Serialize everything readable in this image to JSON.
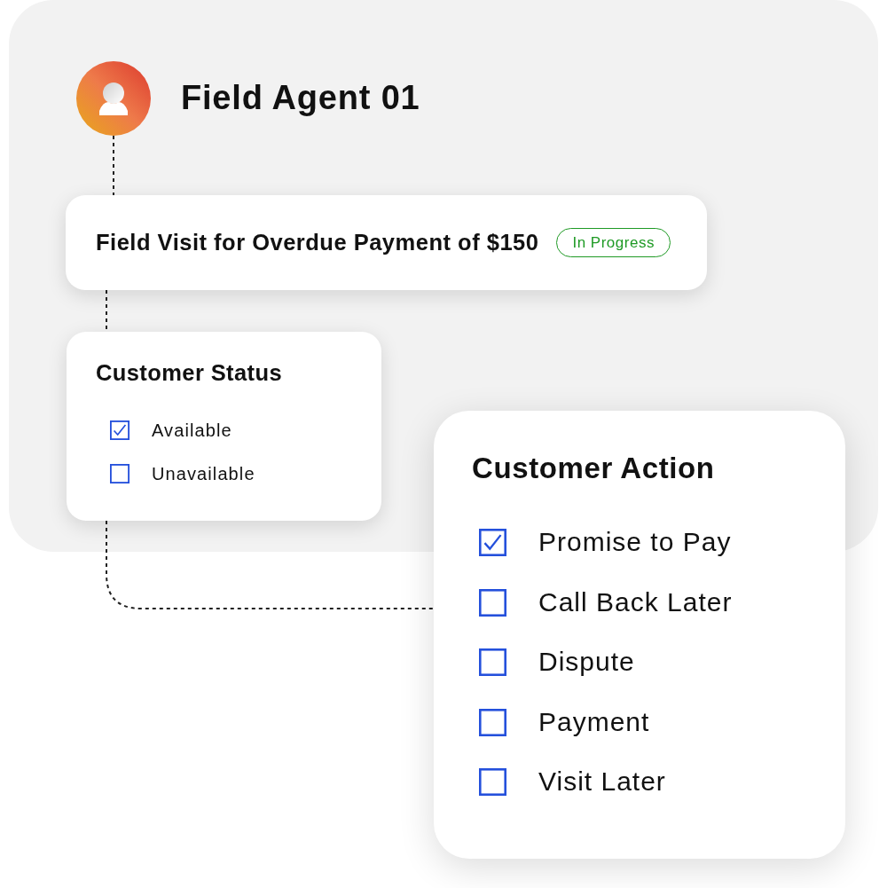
{
  "agent": {
    "name": "Field Agent 01"
  },
  "task": {
    "title": "Field Visit for Overdue Payment of $150",
    "status": "In Progress"
  },
  "customer_status": {
    "title": "Customer Status",
    "options": [
      {
        "label": "Available",
        "checked": true
      },
      {
        "label": "Unavailable",
        "checked": false
      }
    ]
  },
  "customer_action": {
    "title": "Customer Action",
    "options": [
      {
        "label": "Promise to Pay",
        "checked": true
      },
      {
        "label": "Call Back Later",
        "checked": false
      },
      {
        "label": "Dispute",
        "checked": false
      },
      {
        "label": "Payment",
        "checked": false
      },
      {
        "label": "Visit Later",
        "checked": false
      }
    ]
  }
}
